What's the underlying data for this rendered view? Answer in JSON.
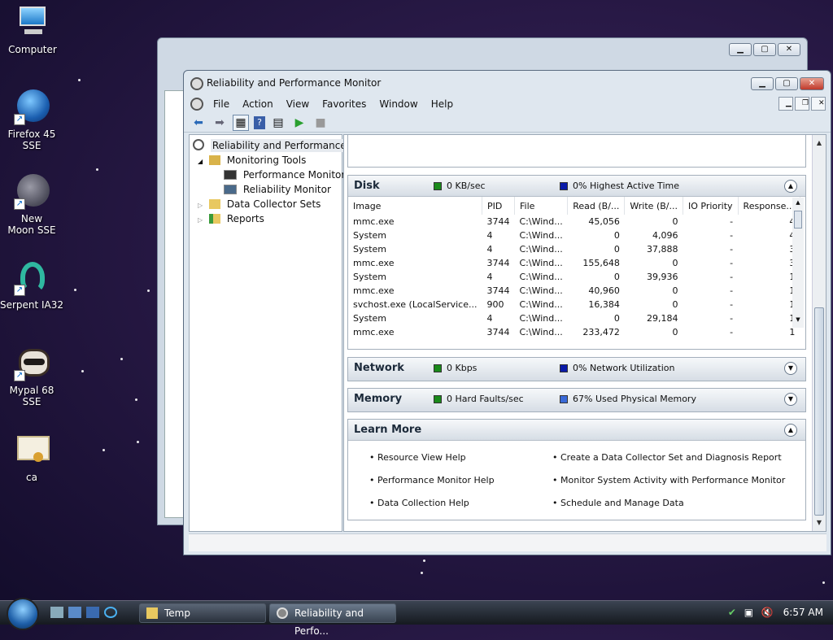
{
  "desktop": {
    "icons": [
      {
        "label": "Computer"
      },
      {
        "label": "Firefox 45 SSE"
      },
      {
        "label": "New Moon SSE"
      },
      {
        "label": "Serpent IA32"
      },
      {
        "label": "Mypal 68 SSE"
      },
      {
        "label": "ca"
      }
    ]
  },
  "window": {
    "title": "Reliability and Performance Monitor",
    "menu": [
      "File",
      "Action",
      "View",
      "Favorites",
      "Window",
      "Help"
    ]
  },
  "tree": {
    "root": "Reliability and Performance",
    "monitoring_tools": "Monitoring Tools",
    "performance_monitor": "Performance Monitor",
    "reliability_monitor": "Reliability Monitor",
    "data_collector_sets": "Data Collector Sets",
    "reports": "Reports"
  },
  "disk": {
    "name": "Disk",
    "indicator1": "0 KB/sec",
    "indicator2": "0% Highest Active Time",
    "color1": "#1a8a1a",
    "color2": "#0a1aa8",
    "columns": [
      "Image",
      "PID",
      "File",
      "Read (B/...",
      "Write (B/...",
      "IO Priority",
      "Response..."
    ],
    "rows": [
      [
        "mmc.exe",
        "3744",
        "C:\\Wind...",
        "45,056",
        "0",
        "-",
        "4"
      ],
      [
        "System",
        "4",
        "C:\\Wind...",
        "0",
        "4,096",
        "-",
        "4"
      ],
      [
        "System",
        "4",
        "C:\\Wind...",
        "0",
        "37,888",
        "-",
        "3"
      ],
      [
        "mmc.exe",
        "3744",
        "C:\\Wind...",
        "155,648",
        "0",
        "-",
        "3"
      ],
      [
        "System",
        "4",
        "C:\\Wind...",
        "0",
        "39,936",
        "-",
        "1"
      ],
      [
        "mmc.exe",
        "3744",
        "C:\\Wind...",
        "40,960",
        "0",
        "-",
        "1"
      ],
      [
        "svchost.exe (LocalService...",
        "900",
        "C:\\Wind...",
        "16,384",
        "0",
        "-",
        "1"
      ],
      [
        "System",
        "4",
        "C:\\Wind...",
        "0",
        "29,184",
        "-",
        "1"
      ],
      [
        "mmc.exe",
        "3744",
        "C:\\Wind...",
        "233,472",
        "0",
        "-",
        "1"
      ]
    ]
  },
  "network": {
    "name": "Network",
    "indicator1": "0 Kbps",
    "indicator2": "0% Network Utilization",
    "color1": "#1a8a1a",
    "color2": "#0a1aa8"
  },
  "memory": {
    "name": "Memory",
    "indicator1": "0 Hard Faults/sec",
    "indicator2": "67% Used Physical Memory",
    "color1": "#1a8a1a",
    "color2": "#3a6ad8"
  },
  "learn_more": {
    "name": "Learn More",
    "left": [
      "Resource View Help",
      "Performance Monitor Help",
      "Data Collection Help"
    ],
    "right": [
      "Create a Data Collector Set and Diagnosis Report",
      "Monitor System Activity with Performance Monitor",
      "Schedule and Manage Data"
    ]
  },
  "taskbar": {
    "tasks": [
      "Temp",
      "Reliability and Perfo..."
    ],
    "clock": "6:57 AM"
  }
}
